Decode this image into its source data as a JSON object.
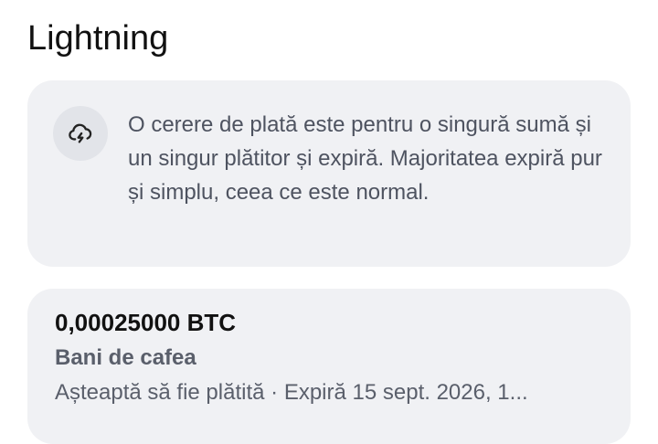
{
  "header": {
    "title": "Lightning"
  },
  "info_card": {
    "icon": "cloud-lightning-icon",
    "text": "O cerere de plată este pentru o singură sumă și un singur plătitor și expiră. Majoritatea expiră pur și simplu, ceea ce este normal."
  },
  "request": {
    "amount": "0,00025000 BTC",
    "label": "Bani de cafea",
    "status": "Așteaptă să fie plătită",
    "separator": " · ",
    "expiry": "Expiră 15 sept. 2026, 1..."
  }
}
